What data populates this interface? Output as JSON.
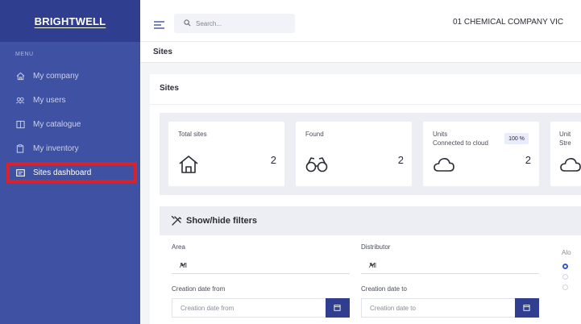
{
  "sidebar": {
    "brand": "BRIGHTWELL",
    "menu_label": "MENU",
    "items": [
      {
        "label": "My company",
        "icon": "home-icon"
      },
      {
        "label": "My users",
        "icon": "users-icon"
      },
      {
        "label": "My catalogue",
        "icon": "book-icon"
      },
      {
        "label": "My inventory",
        "icon": "clipboard-icon"
      },
      {
        "label": "Sites dashboard",
        "icon": "dashboard-icon",
        "active": true
      }
    ]
  },
  "topbar": {
    "search_placeholder": "Search...",
    "company": "01 CHEMICAL COMPANY VIC"
  },
  "breadcrumb": "Sites",
  "panel": {
    "title": "Sites",
    "cards": [
      {
        "label": "Total sites",
        "value": "2",
        "icon": "house-icon"
      },
      {
        "label": "Found",
        "value": "2",
        "icon": "binoculars-icon"
      },
      {
        "label_line1": "Units",
        "label_line2": "Connected to cloud",
        "value": "2",
        "badge": "100 %",
        "icon": "cloud-icon"
      },
      {
        "label_line1": "Unit",
        "label_line2": "Stre",
        "icon": "cloud-icon"
      }
    ]
  },
  "filters": {
    "title": "Show/hide filters",
    "area_label": "Area",
    "area_value": "All",
    "distributor_label": "Distributor",
    "distributor_value": "All",
    "right_label": "Alo",
    "created_from_label": "Creation date from",
    "created_from_placeholder": "Creation date from",
    "created_to_label": "Creation date to",
    "created_to_placeholder": "Creation date to"
  },
  "colors": {
    "sidebar": "#3f51a3",
    "brand_bar": "#2f3e8f",
    "highlight": "#d8232c",
    "accent": "#3a56d8"
  }
}
